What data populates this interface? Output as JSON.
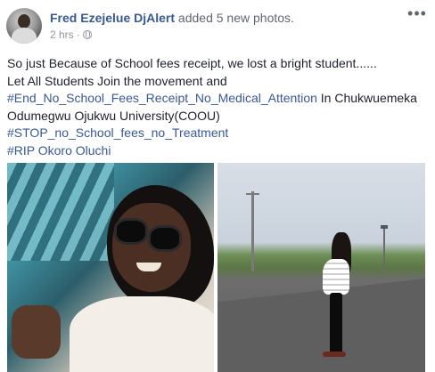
{
  "post": {
    "author_name": "Fred Ezejelue DjAlert",
    "action_text": " added 5 new photos.",
    "time": "2 hrs",
    "separator": "·",
    "audience_icon": "globe-icon",
    "more_icon": "more-options-icon",
    "more_glyph": "•••"
  },
  "text": {
    "line1": "So just Because of School fees receipt, we lost a bright student......",
    "line2": "Let All Students Join the movement and",
    "line3_hashtag": "#End_No_School_Fees_Receipt_No_Medical_Attention",
    "line3_rest": " In Chukwuemeka",
    "line4": "Odumegwu Ojukwu University(COOU)",
    "line5_hashtag": "#STOP_no_School_fees_no_Treatment",
    "line6_hashtag": "#RIP Okoro Oluchi"
  },
  "colors": {
    "link": "#385898",
    "meta": "#90949c",
    "text": "#1d2129"
  }
}
